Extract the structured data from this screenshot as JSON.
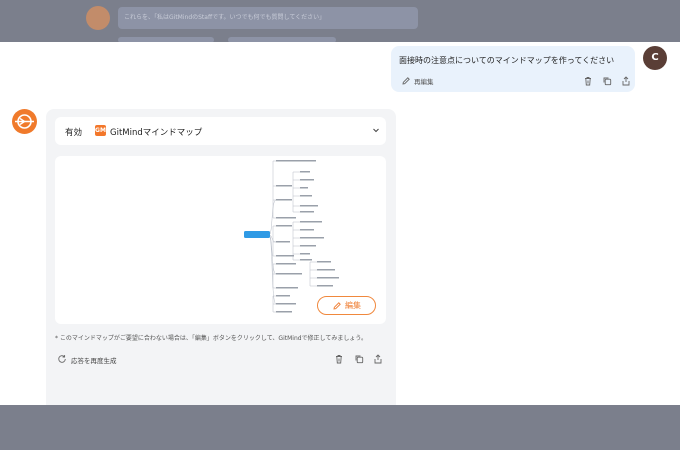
{
  "background_prompt": {
    "text": "これらを、「私はGitMindのStaffです。いつでも何でも質問してください」"
  },
  "user_message": {
    "text": "面接時の注意点についてのマインドマップを作ってください",
    "edit_label": "再編集",
    "avatar_letter": "C"
  },
  "bot_message": {
    "header_prefix": "有効",
    "logo_text": "GM",
    "header_title": "GitMindマインドマップ",
    "edit_button_label": "編集",
    "note": "* このマインドマップがご要望に合わない場合は、「編集」ボタンをクリックして、GitMindで修正してみましょう。",
    "regenerate_label": "応答を再度生成"
  },
  "colors": {
    "accent": "#f07a2b",
    "user_bubble": "#e9f2fc",
    "card_bg": "#f3f4f6",
    "overlay": "#7b7f8c",
    "mindmap_root": "#2f9ae5"
  },
  "icons": {
    "edit": "pencil-icon",
    "delete": "trash-icon",
    "copy": "copy-icon",
    "share": "share-icon",
    "chevron": "chevron-down-icon",
    "regenerate": "refresh-icon"
  }
}
